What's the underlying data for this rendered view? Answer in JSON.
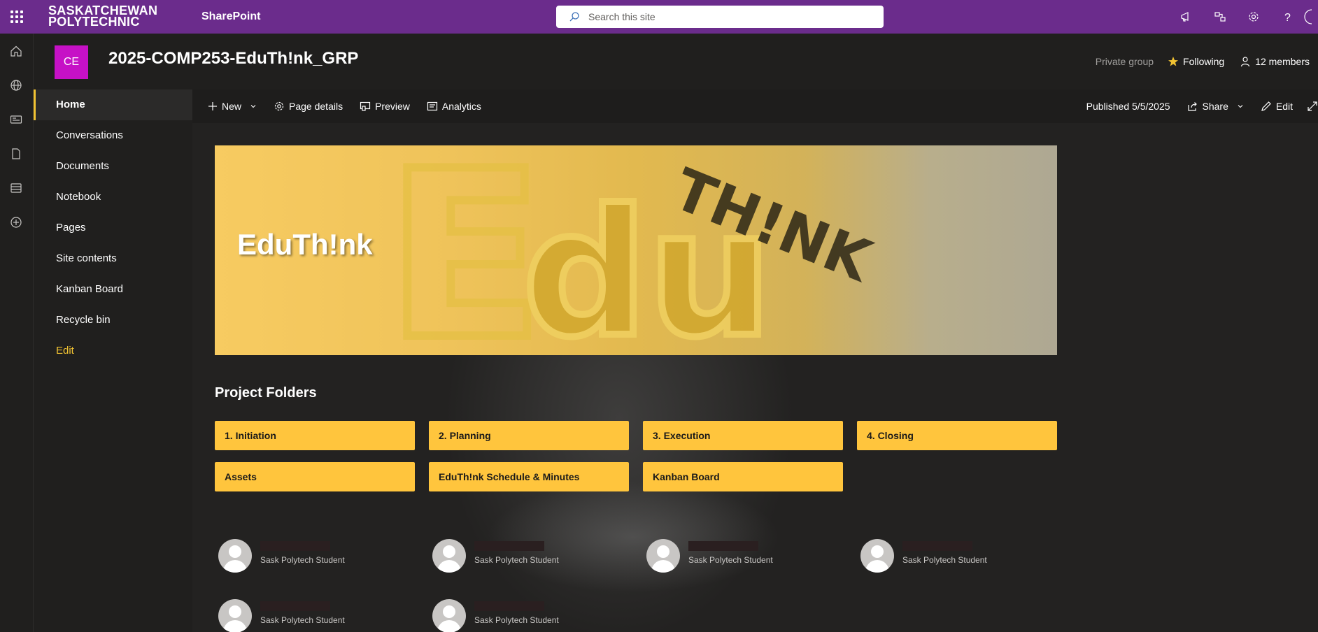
{
  "suite": {
    "org_line1": "SASKATCHEWAN",
    "org_line2": "POLYTECHNIC",
    "app_name": "SharePoint",
    "search_placeholder": "Search this site"
  },
  "site": {
    "logo_initials": "CE",
    "title": "2025-COMP253-EduTh!nk_GRP",
    "privacy": "Private group",
    "follow_label": "Following",
    "members_label": "12 members"
  },
  "nav": {
    "items": [
      "Home",
      "Conversations",
      "Documents",
      "Notebook",
      "Pages",
      "Site contents",
      "Kanban Board",
      "Recycle bin"
    ],
    "edit_label": "Edit",
    "selected": "Home"
  },
  "commandbar": {
    "new_label": "New",
    "page_details_label": "Page details",
    "preview_label": "Preview",
    "analytics_label": "Analytics",
    "published_label": "Published 5/5/2025",
    "share_label": "Share",
    "edit_label": "Edit"
  },
  "hero": {
    "title": "EduTh!nk",
    "image_lettering": "EduTH!NK"
  },
  "folders": {
    "title": "Project Folders",
    "items": [
      "1. Initiation",
      "2. Planning",
      "3. Execution",
      "4. Closing",
      "Assets",
      "EduTh!nk Schedule & Minutes",
      "Kanban Board"
    ]
  },
  "people": {
    "role": "Sask Polytech Student"
  },
  "colors": {
    "suite_bar": "#6b2c8c",
    "accent": "#f1c232",
    "folder_button": "#ffc53d",
    "site_logo": "#c611c6"
  },
  "icons": [
    "waffle-icon",
    "search-icon",
    "megaphone-icon",
    "share-network-icon",
    "gear-icon",
    "help-icon",
    "home-icon",
    "globe-icon",
    "news-icon",
    "file-icon",
    "list-icon",
    "add-circle-icon",
    "star-icon",
    "person-icon",
    "add-icon",
    "chevron-down-icon",
    "settings-icon",
    "preview-icon",
    "analytics-icon",
    "share-icon",
    "pencil-icon",
    "expand-icon"
  ]
}
